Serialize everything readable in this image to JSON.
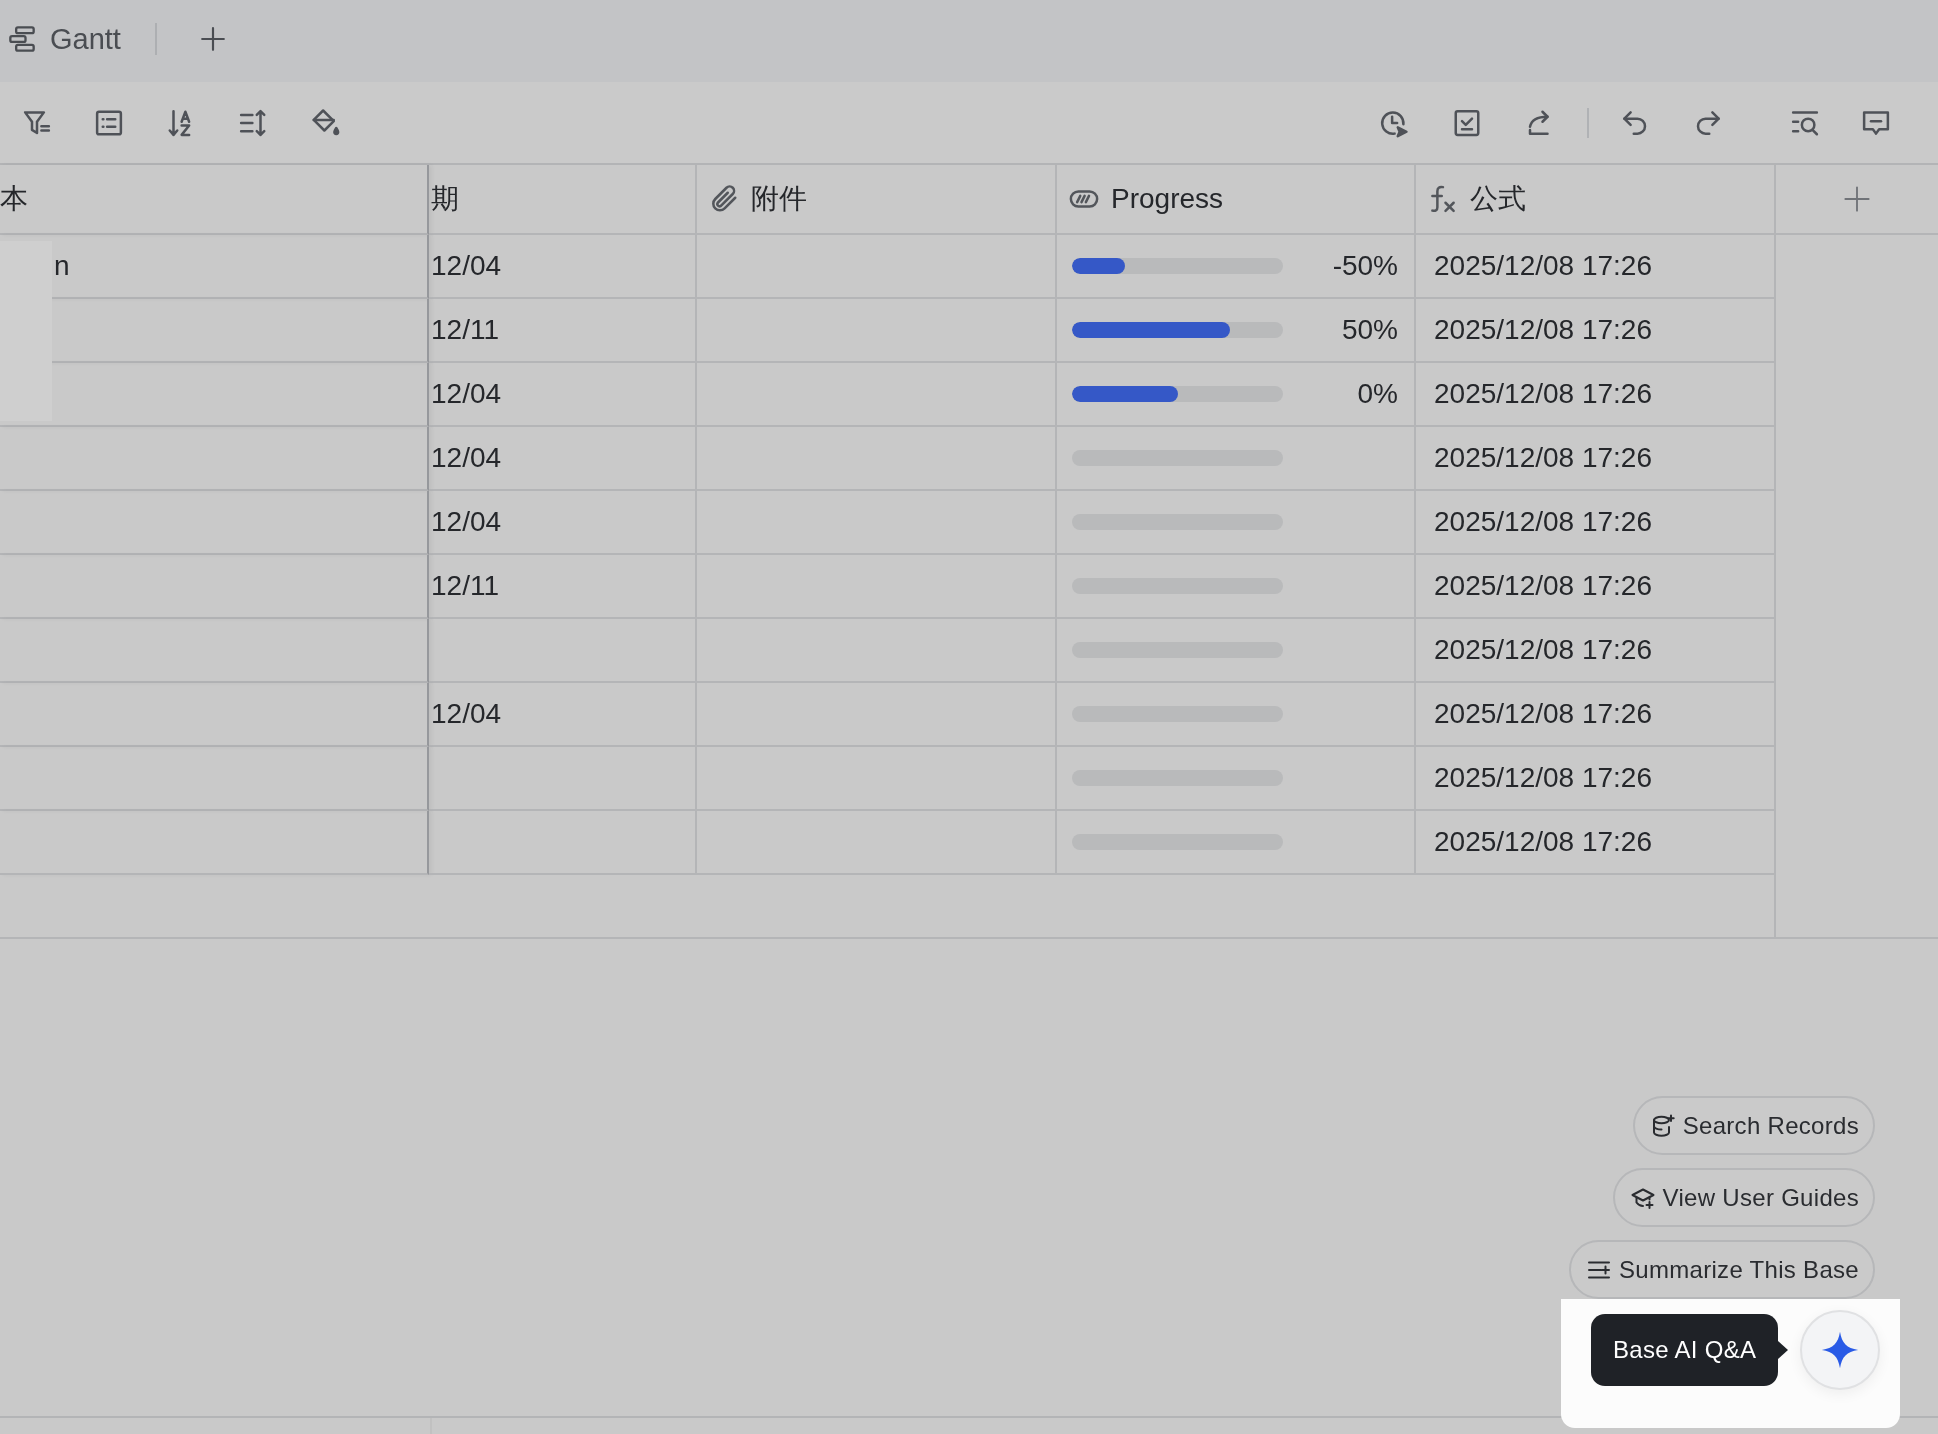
{
  "tab_bar": {
    "views": [
      {
        "label": "Gantt"
      }
    ]
  },
  "table": {
    "columns": [
      {
        "kind": "plain",
        "label": "本"
      },
      {
        "kind": "plain",
        "label": "期"
      },
      {
        "kind": "attachment",
        "label": "附件"
      },
      {
        "kind": "progress",
        "label": "Progress"
      },
      {
        "kind": "formula",
        "label": "公式"
      }
    ],
    "rows": [
      {
        "column_1": "n",
        "column_2": "12/04",
        "progress": {
          "level": 0.25,
          "reading": "-50%"
        },
        "formula": "2025/12/08 17:26"
      },
      {
        "column_2": "12/11",
        "progress": {
          "level": 0.75,
          "reading": "50%"
        },
        "formula": "2025/12/08 17:26"
      },
      {
        "column_2": "12/04",
        "progress": {
          "level": 0.5,
          "reading": "0%"
        },
        "formula": "2025/12/08 17:26"
      },
      {
        "column_2": "12/04",
        "formula": "2025/12/08 17:26"
      },
      {
        "column_2": "12/04",
        "formula": "2025/12/08 17:26"
      },
      {
        "column_2": "12/11",
        "formula": "2025/12/08 17:26"
      },
      {
        "formula": "2025/12/08 17:26"
      },
      {
        "column_2": "12/04",
        "formula": "2025/12/08 17:26"
      },
      {
        "formula": "2025/12/08 17:26"
      },
      {
        "formula": "2025/12/08 17:26"
      }
    ]
  },
  "ai_assistant": {
    "suggestions": [
      {
        "kind": "search",
        "label": "Search Records"
      },
      {
        "kind": "guides",
        "label": "View User Guides"
      },
      {
        "kind": "summarize",
        "label": "Summarize This Base"
      }
    ],
    "tooltip": "Base AI Q&A"
  }
}
